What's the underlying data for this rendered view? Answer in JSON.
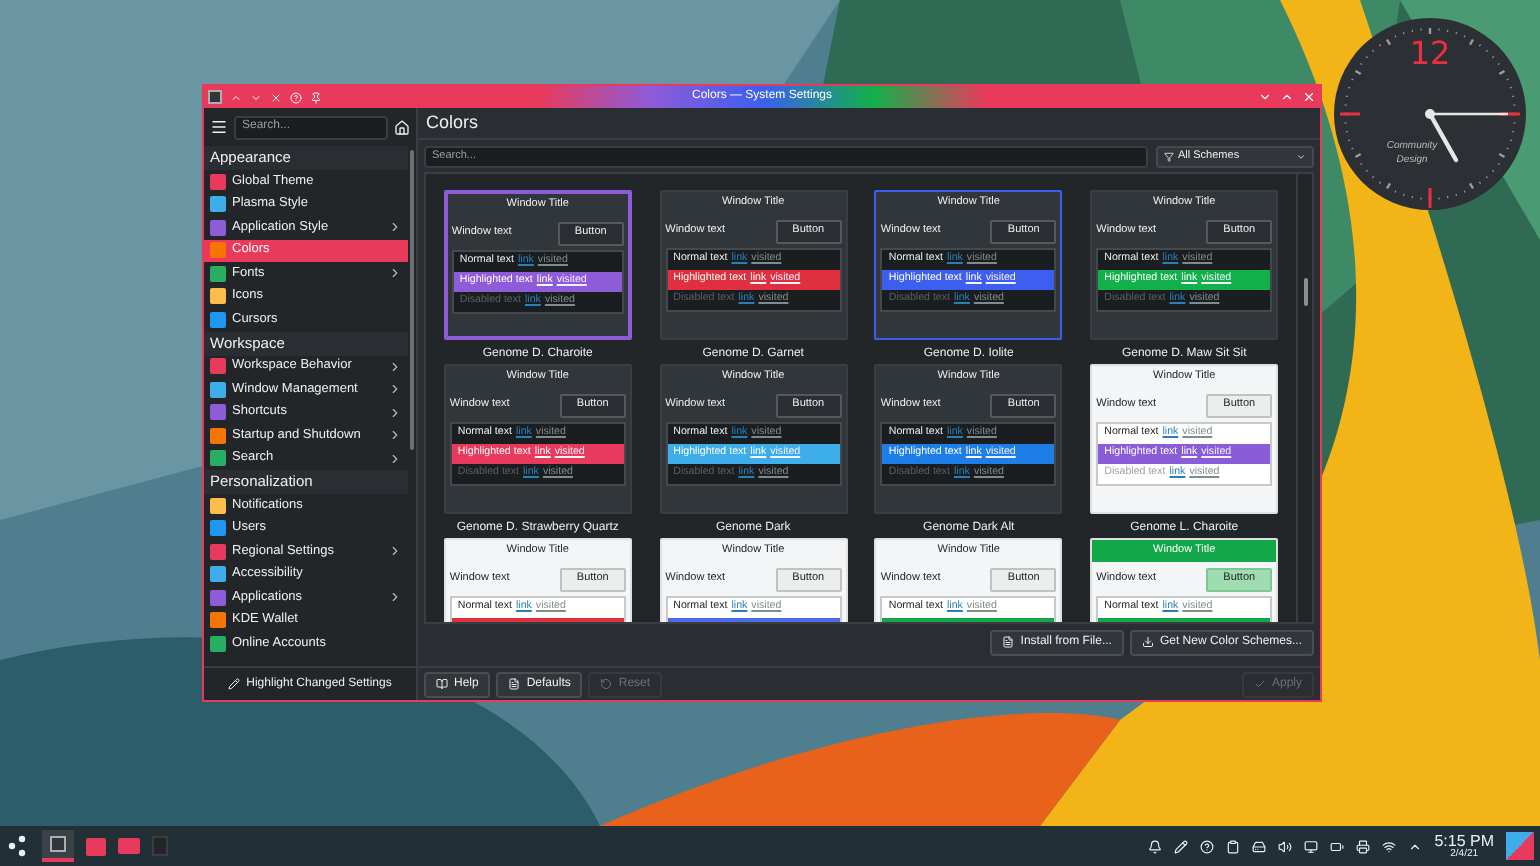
{
  "window": {
    "title": "Colors — System Settings"
  },
  "sidebar": {
    "search_placeholder": "Search...",
    "sections": [
      {
        "title": "Appearance",
        "items": [
          {
            "label": "Global Theme",
            "selected": false,
            "expandable": false
          },
          {
            "label": "Plasma Style",
            "selected": false,
            "expandable": false
          },
          {
            "label": "Application Style",
            "selected": false,
            "expandable": true
          },
          {
            "label": "Colors",
            "selected": true,
            "expandable": false
          },
          {
            "label": "Fonts",
            "selected": false,
            "expandable": true
          },
          {
            "label": "Icons",
            "selected": false,
            "expandable": false
          },
          {
            "label": "Cursors",
            "selected": false,
            "expandable": false
          }
        ]
      },
      {
        "title": "Workspace",
        "items": [
          {
            "label": "Workspace Behavior",
            "selected": false,
            "expandable": true
          },
          {
            "label": "Window Management",
            "selected": false,
            "expandable": true
          },
          {
            "label": "Shortcuts",
            "selected": false,
            "expandable": true
          },
          {
            "label": "Startup and Shutdown",
            "selected": false,
            "expandable": true
          },
          {
            "label": "Search",
            "selected": false,
            "expandable": true
          }
        ]
      },
      {
        "title": "Personalization",
        "items": [
          {
            "label": "Notifications",
            "selected": false,
            "expandable": false
          },
          {
            "label": "Users",
            "selected": false,
            "expandable": false
          },
          {
            "label": "Regional Settings",
            "selected": false,
            "expandable": true
          },
          {
            "label": "Accessibility",
            "selected": false,
            "expandable": false
          },
          {
            "label": "Applications",
            "selected": false,
            "expandable": true
          },
          {
            "label": "KDE Wallet",
            "selected": false,
            "expandable": false
          },
          {
            "label": "Online Accounts",
            "selected": false,
            "expandable": false
          }
        ]
      }
    ],
    "footer_button": "Highlight Changed Settings"
  },
  "page": {
    "title": "Colors",
    "search_placeholder": "Search...",
    "filter": "All Schemes",
    "schemes": [
      {
        "name": "Genome D. Charoite",
        "selected": true,
        "hovered": false,
        "kind": "dark",
        "color": "#8e5bd9",
        "titlebar_colored": false,
        "preview": {
          "title": "Window Title",
          "window_text": "Window text",
          "button": "Button",
          "normal": "Normal text",
          "link": "link",
          "visited": "visited",
          "highlighted": "Highlighted text",
          "highlighted_link": "link",
          "highlighted_visited": "visited",
          "disabled": "Disabled text",
          "disabled_link": "link",
          "disabled_visited": "visited"
        }
      },
      {
        "name": "Genome D. Garnet",
        "selected": false,
        "hovered": false,
        "kind": "dark",
        "color": "#e0303f",
        "titlebar_colored": false,
        "preview": {
          "title": "Window Title",
          "window_text": "Window text",
          "button": "Button",
          "normal": "Normal text",
          "link": "link",
          "visited": "visited",
          "highlighted": "Highlighted text",
          "highlighted_link": "link",
          "highlighted_visited": "visited",
          "disabled": "Disabled text",
          "disabled_link": "link",
          "disabled_visited": "visited"
        }
      },
      {
        "name": "Genome D. Iolite",
        "selected": false,
        "hovered": true,
        "kind": "dark",
        "color": "#3d5ff0",
        "titlebar_colored": false,
        "preview": {
          "title": "Window Title",
          "window_text": "Window text",
          "button": "Button",
          "normal": "Normal text",
          "link": "link",
          "visited": "visited",
          "highlighted": "Highlighted text",
          "highlighted_link": "link",
          "highlighted_visited": "visited",
          "disabled": "Disabled text",
          "disabled_link": "link",
          "disabled_visited": "visited"
        }
      },
      {
        "name": "Genome D. Maw Sit Sit",
        "selected": false,
        "hovered": false,
        "kind": "dark",
        "color": "#12b04a",
        "titlebar_colored": false,
        "preview": {
          "title": "Window Title",
          "window_text": "Window text",
          "button": "Button",
          "normal": "Normal text",
          "link": "link",
          "visited": "visited",
          "highlighted": "Highlighted text",
          "highlighted_link": "link",
          "highlighted_visited": "visited",
          "disabled": "Disabled text",
          "disabled_link": "link",
          "disabled_visited": "visited"
        }
      },
      {
        "name": "Genome D. Strawberry Quartz",
        "selected": false,
        "hovered": false,
        "kind": "dark",
        "color": "#e83a5c",
        "titlebar_colored": false,
        "preview": {
          "title": "Window Title",
          "window_text": "Window text",
          "button": "Button",
          "normal": "Normal text",
          "link": "link",
          "visited": "visited",
          "highlighted": "Highlighted text",
          "highlighted_link": "link",
          "highlighted_visited": "visited",
          "disabled": "Disabled text",
          "disabled_link": "link",
          "disabled_visited": "visited"
        }
      },
      {
        "name": "Genome Dark",
        "selected": false,
        "hovered": false,
        "kind": "dark",
        "color": "#3daee9",
        "titlebar_colored": false,
        "preview": {
          "title": "Window Title",
          "window_text": "Window text",
          "button": "Button",
          "normal": "Normal text",
          "link": "link",
          "visited": "visited",
          "highlighted": "Highlighted text",
          "highlighted_link": "link",
          "highlighted_visited": "visited",
          "disabled": "Disabled text",
          "disabled_link": "link",
          "disabled_visited": "visited"
        }
      },
      {
        "name": "Genome Dark Alt",
        "selected": false,
        "hovered": false,
        "kind": "dark",
        "color": "#1d7ee8",
        "titlebar_colored": false,
        "preview": {
          "title": "Window Title",
          "window_text": "Window text",
          "button": "Button",
          "normal": "Normal text",
          "link": "link",
          "visited": "visited",
          "highlighted": "Highlighted text",
          "highlighted_link": "link",
          "highlighted_visited": "visited",
          "disabled": "Disabled text",
          "disabled_link": "link",
          "disabled_visited": "visited"
        }
      },
      {
        "name": "Genome L. Charoite",
        "selected": false,
        "hovered": false,
        "kind": "light",
        "color": "#8b5cd8",
        "titlebar_colored": false,
        "preview": {
          "title": "Window Title",
          "window_text": "Window text",
          "button": "Button",
          "normal": "Normal text",
          "link": "link",
          "visited": "visited",
          "highlighted": "Highlighted text",
          "highlighted_link": "link",
          "highlighted_visited": "visited",
          "disabled": "Disabled text",
          "disabled_link": "link",
          "disabled_visited": "visited"
        }
      },
      {
        "selected": false,
        "hovered": false,
        "kind": "light",
        "color": "#e0303f",
        "titlebar_colored": false,
        "preview": {
          "title": "Window Title",
          "window_text": "Window text",
          "button": "Button",
          "normal": "Normal text",
          "link": "link",
          "visited": "visited"
        }
      },
      {
        "selected": false,
        "hovered": false,
        "kind": "light",
        "color": "#4c6ae8",
        "titlebar_colored": false,
        "preview": {
          "title": "Window Title",
          "window_text": "Window text",
          "button": "Button",
          "normal": "Normal text",
          "link": "link",
          "visited": "visited"
        }
      },
      {
        "selected": false,
        "hovered": false,
        "kind": "light",
        "color": "#12a84a",
        "titlebar_colored": false,
        "preview": {
          "title": "Window Title",
          "window_text": "Window text",
          "button": "Button",
          "normal": "Normal text",
          "link": "link",
          "visited": "visited"
        }
      },
      {
        "selected": false,
        "hovered": false,
        "kind": "light",
        "color": "#12a84a",
        "titlebar_colored": true,
        "preview": {
          "title": "Window Title",
          "window_text": "Window text",
          "button": "Button",
          "normal": "Normal text",
          "link": "link",
          "visited": "visited"
        }
      }
    ],
    "file_buttons": [
      "Install from File...",
      "Get New Color Schemes..."
    ],
    "buttons": [
      {
        "label": "Help",
        "disabled": false
      },
      {
        "label": "Defaults",
        "disabled": false
      },
      {
        "label": "Reset",
        "disabled": true
      }
    ],
    "apply_button": {
      "label": "Apply",
      "disabled": true
    }
  },
  "clock": {
    "hour_label": "12",
    "brand": [
      "Community",
      "Design"
    ]
  },
  "taskbar": {
    "time": "5:15 PM",
    "date": "2/4/21"
  }
}
